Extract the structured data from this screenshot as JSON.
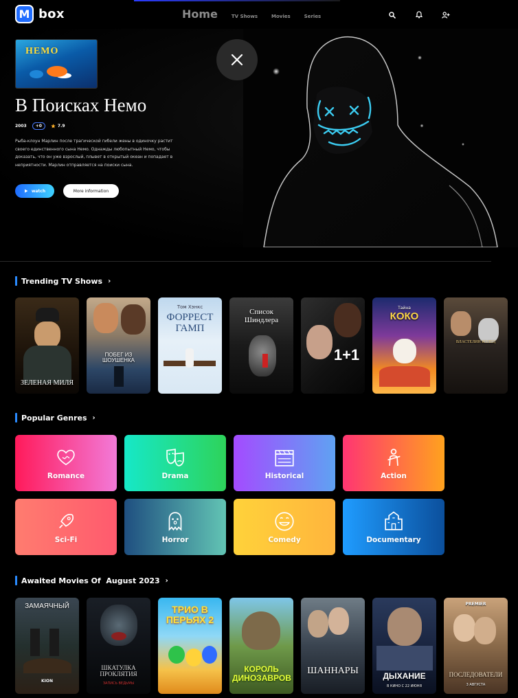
{
  "app": {
    "logo_letter": "M",
    "name": "box"
  },
  "nav": {
    "home": "Home",
    "links": [
      "TV Shows",
      "Movies",
      "Series"
    ]
  },
  "icons": {
    "search": "search-icon",
    "bell": "bell-icon",
    "add_user": "add-user-icon",
    "close": "close-icon",
    "play": "play-icon",
    "star": "star-icon",
    "chevron": "chevron-right-icon"
  },
  "hero": {
    "poster_title": "НЕМО",
    "title": "В Поисках Немо",
    "year": "2003",
    "age": "+0",
    "rating": "7.9",
    "description": "Рыба-клоун Марлин после трагической гибели жены в одиночку растит своего единственного сына Немо. Однажды любопытный Немо, чтобы доказать, что он уже взрослый, плывет в открытый океан и попадает в неприятности. Марлин отправляется на поиски сына.",
    "watch_label": "watch",
    "more_label": "More information"
  },
  "trending": {
    "title": "Trending TV Shows",
    "posters": [
      {
        "title": "ЗЕЛЕНАЯ МИЛЯ"
      },
      {
        "title": "ПОБЕГ ИЗ ШОУШЕНКА"
      },
      {
        "top": "Том Хэнкс",
        "title": "ФОРРЕСТ ГАМП"
      },
      {
        "title": "Список Шиндлера"
      },
      {
        "title": "1+1"
      },
      {
        "top": "Тайна",
        "title": "КОКО"
      },
      {
        "title": "ВЛАСТЕЛИН КОЛЕЦ"
      }
    ]
  },
  "genres": {
    "title": "Popular Genres",
    "items": [
      {
        "label": "Romance",
        "icon": "hearts-icon"
      },
      {
        "label": "Drama",
        "icon": "theater-masks-icon"
      },
      {
        "label": "Historical",
        "icon": "clapperboard-history-icon"
      },
      {
        "label": "Action",
        "icon": "soldier-icon"
      },
      {
        "label": "Sci-Fi",
        "icon": "rocket-icon"
      },
      {
        "label": "Horror",
        "icon": "ghost-icon"
      },
      {
        "label": "Comedy",
        "icon": "smile-icon"
      },
      {
        "label": "Documentary",
        "icon": "building-icon"
      }
    ]
  },
  "awaited": {
    "title": "Awaited Movies Of  August 2023",
    "posters": [
      {
        "title": "ЗАМАЯЧНЫЙ",
        "bottom": "KION"
      },
      {
        "title": "ШКАТУЛКА ПРОКЛЯТИЯ",
        "sub": "ЗАПИСЬ ВЕДЬМЫ"
      },
      {
        "title": "ТРИО В ПЕРЬЯХ 2"
      },
      {
        "title": "КОРОЛЬ ДИНОЗАВРОВ"
      },
      {
        "title": "ШАННАРЫ"
      },
      {
        "title": "ДЫХАНИЕ",
        "sub": "В КИНО С 22 ИЮНЯ"
      },
      {
        "top": "PREMIER",
        "title": "ПОСЛЕДОВАТЕЛИ",
        "sub": "3 АВГУСТА"
      }
    ]
  },
  "colors": {
    "accent": "#2a8bff",
    "genre_romance": [
      "#ff1a5a",
      "#f27ad8"
    ],
    "genre_drama": [
      "#16e8c8",
      "#2ed35a"
    ],
    "genre_historical": [
      "#a44bff",
      "#5fa2f2"
    ],
    "genre_action": [
      "#ff3572",
      "#ffa21e"
    ],
    "genre_scifi": [
      "#ff7c6f",
      "#ff5a6e"
    ],
    "genre_horror": [
      "#1f4f80",
      "#62c4b4"
    ],
    "genre_comedy": [
      "#ffd23a",
      "#ffb53d"
    ],
    "genre_documentary": [
      "#1f9cff",
      "#0b4f9c"
    ]
  }
}
